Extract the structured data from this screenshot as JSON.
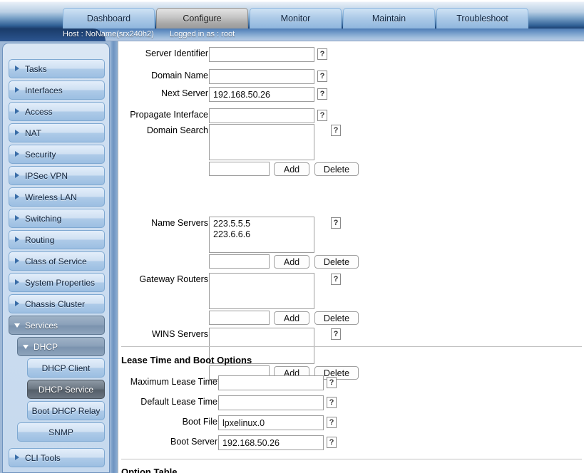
{
  "tabs": [
    {
      "label": "Dashboard",
      "active": false
    },
    {
      "label": "Configure",
      "active": true
    },
    {
      "label": "Monitor",
      "active": false
    },
    {
      "label": "Maintain",
      "active": false
    },
    {
      "label": "Troubleshoot",
      "active": false
    }
  ],
  "hostbar": {
    "host": "Host : NoName(srx240h2)",
    "user": "Logged in as : root"
  },
  "sidebar": {
    "items": [
      {
        "label": "Tasks",
        "level": 0,
        "state": "collapsed"
      },
      {
        "label": "Interfaces",
        "level": 0,
        "state": "collapsed"
      },
      {
        "label": "Access",
        "level": 0,
        "state": "collapsed"
      },
      {
        "label": "NAT",
        "level": 0,
        "state": "collapsed"
      },
      {
        "label": "Security",
        "level": 0,
        "state": "collapsed"
      },
      {
        "label": "IPSec VPN",
        "level": 0,
        "state": "collapsed"
      },
      {
        "label": "Wireless LAN",
        "level": 0,
        "state": "collapsed"
      },
      {
        "label": "Switching",
        "level": 0,
        "state": "collapsed"
      },
      {
        "label": "Routing",
        "level": 0,
        "state": "collapsed"
      },
      {
        "label": "Class of Service",
        "level": 0,
        "state": "collapsed"
      },
      {
        "label": "System Properties",
        "level": 0,
        "state": "collapsed"
      },
      {
        "label": "Chassis Cluster",
        "level": 0,
        "state": "collapsed"
      },
      {
        "label": "Services",
        "level": 0,
        "state": "expanded"
      },
      {
        "label": "DHCP",
        "level": 1,
        "state": "expanded"
      },
      {
        "label": "DHCP Client",
        "level": 2,
        "state": "normal"
      },
      {
        "label": "DHCP Service",
        "level": 2,
        "state": "selected"
      },
      {
        "label": "Boot DHCP Relay",
        "level": 2,
        "state": "normal"
      },
      {
        "label": "SNMP",
        "level": 1,
        "state": "normal"
      },
      {
        "label": "CLI Tools",
        "level": 0,
        "state": "collapsed"
      }
    ]
  },
  "main": {
    "help_glyph": "?",
    "fields": [
      {
        "label": "Server Identifier",
        "value": "",
        "placeholder": ""
      },
      {
        "label": "Domain Name",
        "value": "",
        "placeholder": ""
      },
      {
        "label": "Next Server",
        "value": "192.168.50.26",
        "placeholder": ""
      },
      {
        "label": "Propagate Interface",
        "value": "",
        "placeholder": ""
      }
    ],
    "lists": [
      {
        "label": "Domain Search",
        "value": "",
        "entry_value": "",
        "add_label": "Add",
        "delete_label": "Delete"
      },
      {
        "label": "Name Servers",
        "value": "223.5.5.5\n223.6.6.6",
        "entry_value": "",
        "add_label": "Add",
        "delete_label": "Delete"
      },
      {
        "label": "Gateway Routers",
        "value": "",
        "entry_value": "",
        "add_label": "Add",
        "delete_label": "Delete"
      },
      {
        "label": "WINS Servers",
        "value": "",
        "entry_value": "",
        "add_label": "Add",
        "delete_label": "Delete"
      }
    ],
    "lease_section": {
      "title": "Lease Time and Boot Options",
      "fields": [
        {
          "label": "Maximum Lease Time",
          "value": "",
          "placeholder": ""
        },
        {
          "label": "Default Lease Time",
          "value": "",
          "placeholder": ""
        },
        {
          "label": "Boot File",
          "value": "lpxelinux.0",
          "placeholder": ""
        },
        {
          "label": "Boot Server",
          "value": "192.168.50.26",
          "placeholder": ""
        }
      ]
    },
    "option_section": {
      "title": "Option Table"
    }
  },
  "colors": {
    "tab_active": "#a8a8a8",
    "tab_inactive": "#aecbe8",
    "sidebar_selected": "#545e69",
    "header_blue": "#2f5f95"
  }
}
